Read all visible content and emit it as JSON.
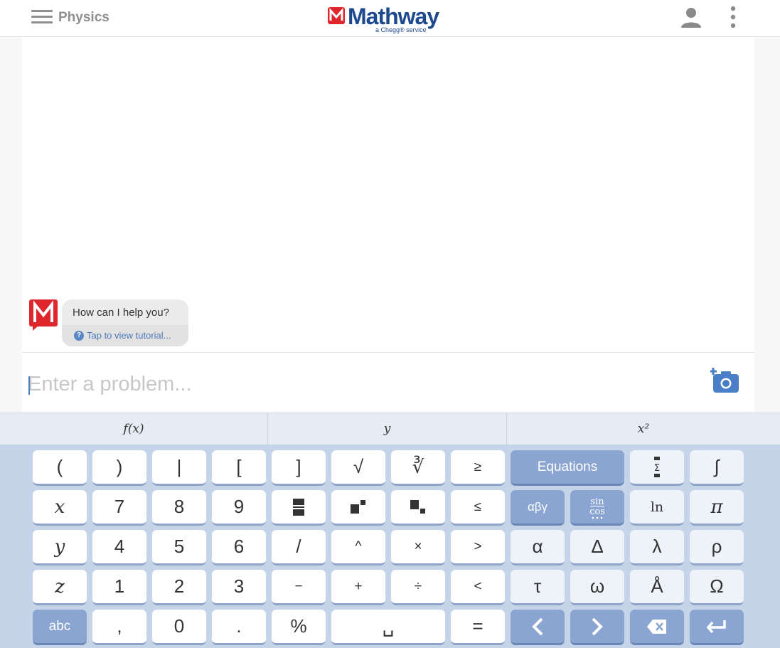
{
  "header": {
    "subject": "Physics",
    "logo": {
      "mark": "M",
      "name": "Mathway",
      "tagline": "a Chegg® service"
    },
    "icons": {
      "menu": "hamburger-icon",
      "account": "user-icon",
      "more": "kebab-menu-icon"
    }
  },
  "chat": {
    "message": "How can I help you?",
    "tutorial_link": "Tap to view tutorial..."
  },
  "input": {
    "placeholder": "Enter a problem...",
    "value": ""
  },
  "keyboard_tabs": [
    "f(x)",
    "y",
    "x²"
  ],
  "keyboard": {
    "rows": [
      [
        "(",
        ")",
        "|",
        "[",
        "]",
        "√",
        "∛",
        "≥",
        "Equations",
        "Σ",
        "∫"
      ],
      [
        "x",
        "7",
        "8",
        "9",
        "",
        "",
        "",
        "≤",
        "αβγ",
        "sin cos",
        "ln",
        "π"
      ],
      [
        "y",
        "4",
        "5",
        "6",
        "/",
        "^",
        "×",
        ">",
        "α",
        "Δ",
        "λ",
        "ρ"
      ],
      [
        "z",
        "1",
        "2",
        "3",
        "−",
        "+",
        "÷",
        "<",
        "τ",
        "ω",
        "Å",
        "Ω"
      ],
      [
        "abc",
        ",",
        "0",
        ".",
        "%",
        "␣",
        "=",
        "<",
        ">",
        "⌫",
        "↵"
      ]
    ]
  },
  "colors": {
    "brand_red": "#e0262d",
    "brand_blue": "#1d4a8e",
    "keyboard_bg": "#c6d4ea",
    "key_accent": "#8aa5d2"
  }
}
